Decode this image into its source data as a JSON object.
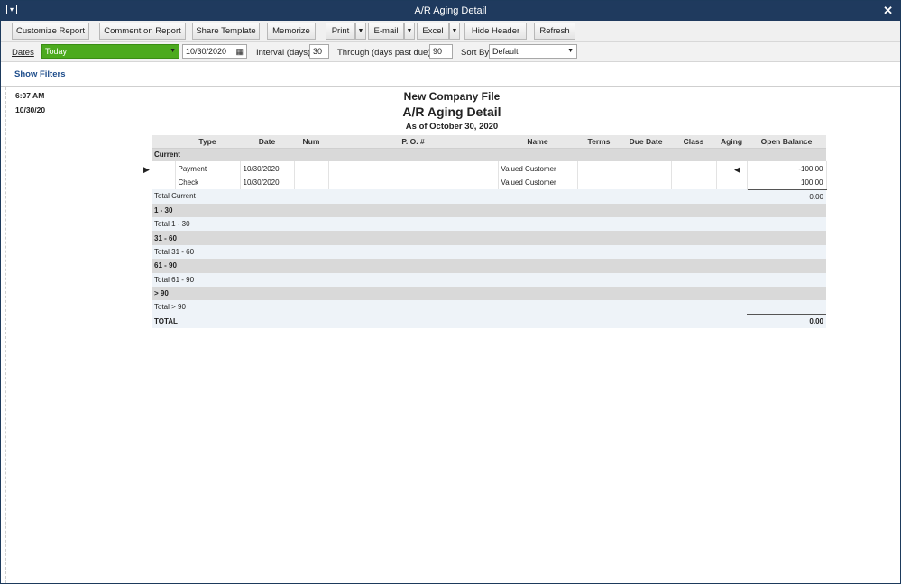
{
  "window": {
    "title": "A/R Aging Detail"
  },
  "toolbar": {
    "customize": "Customize Report",
    "comment": "Comment on Report",
    "share": "Share Template",
    "memorize": "Memorize",
    "print": "Print",
    "email": "E-mail",
    "excel": "Excel",
    "hide_header": "Hide Header",
    "refresh": "Refresh"
  },
  "filters": {
    "dates_label": "Dates",
    "dates_value": "Today",
    "date_value": "10/30/2020",
    "interval_label": "Interval (days)",
    "interval_value": "30",
    "through_label": "Through (days past due)",
    "through_value": "90",
    "sortby_label": "Sort By",
    "sortby_value": "Default",
    "show_filters": "Show Filters"
  },
  "report": {
    "time": "6:07 AM",
    "date": "10/30/20",
    "company": "New Company File",
    "title": "A/R Aging Detail",
    "asof": "As of October 30, 2020",
    "columns": [
      "Type",
      "Date",
      "Num",
      "P. O. #",
      "Name",
      "Terms",
      "Due Date",
      "Class",
      "Aging",
      "Open Balance"
    ],
    "rows": [
      {
        "kind": "sec",
        "label": "Current"
      },
      {
        "kind": "item",
        "type": "Payment",
        "date": "10/30/2020",
        "name": "Valued Customer",
        "balance": "-100.00"
      },
      {
        "kind": "item",
        "type": "Check",
        "date": "10/30/2020",
        "name": "Valued Customer",
        "balance": "100.00"
      },
      {
        "kind": "tot",
        "label": "Total Current",
        "balance": "0.00"
      },
      {
        "kind": "sec",
        "label": "1 - 30"
      },
      {
        "kind": "tot",
        "label": "Total 1 - 30",
        "balance": ""
      },
      {
        "kind": "sec",
        "label": "31 - 60"
      },
      {
        "kind": "tot",
        "label": "Total 31 - 60",
        "balance": ""
      },
      {
        "kind": "sec",
        "label": "61 - 90"
      },
      {
        "kind": "tot",
        "label": "Total 61 - 90",
        "balance": ""
      },
      {
        "kind": "sec",
        "label": "> 90"
      },
      {
        "kind": "tot",
        "label": "Total > 90",
        "balance": ""
      },
      {
        "kind": "grand",
        "label": "TOTAL",
        "balance": "0.00"
      }
    ]
  },
  "colors": {
    "titlebar": "#1f3a5e",
    "dates_highlight": "#4caa1e",
    "link": "#1f4e8c"
  }
}
